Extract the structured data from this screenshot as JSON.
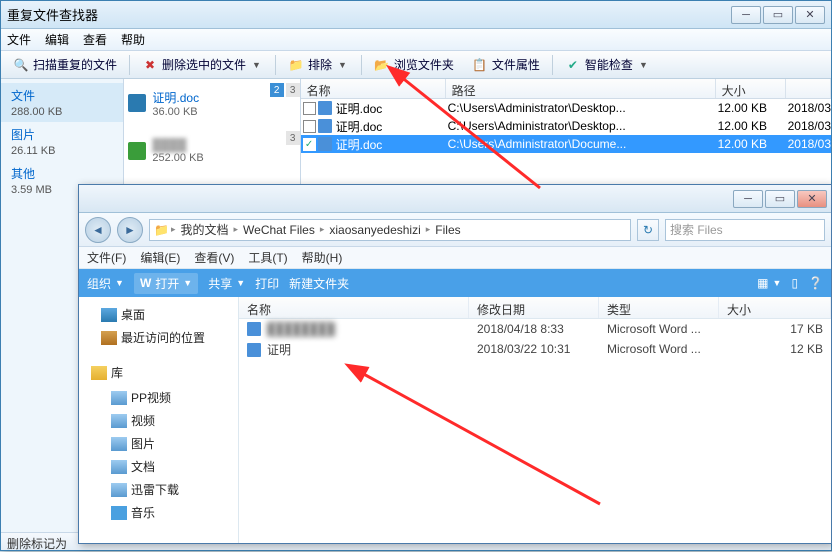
{
  "win1": {
    "title": "重复文件查找器",
    "menu": {
      "file": "文件",
      "edit": "编辑",
      "view": "查看",
      "help": "帮助"
    },
    "toolbar": {
      "scan": "扫描重复的文件",
      "del": "删除选中的文件",
      "sort": "排除",
      "browse": "  浏览文件夹",
      "prop": "文件属性",
      "smart": "智能检查"
    },
    "cats": [
      {
        "label": "文件",
        "size": "288.00 KB"
      },
      {
        "label": "图片",
        "size": "26.11 KB"
      },
      {
        "label": "其他",
        "size": "3.59 MB"
      }
    ],
    "thumbs": [
      {
        "name": "证明.doc",
        "size": "36.00 KB",
        "tabs": [
          "2",
          "3"
        ]
      },
      {
        "name": "",
        "size": "252.00 KB",
        "tabs": [
          "3"
        ]
      }
    ],
    "listhdr": {
      "name": "名称",
      "path": "路径",
      "size": "大小",
      "date": ""
    },
    "rows": [
      {
        "chk": false,
        "name": "证明.doc",
        "path": "C:\\Users\\Administrator\\Desktop...",
        "size": "12.00 KB",
        "date": "2018/03"
      },
      {
        "chk": false,
        "name": "证明.doc",
        "path": "C:\\Users\\Administrator\\Desktop...",
        "size": "12.00 KB",
        "date": "2018/03"
      },
      {
        "chk": true,
        "name": "证明.doc",
        "path": "C:\\Users\\Administrator\\Docume...",
        "size": "12.00 KB",
        "date": "2018/03",
        "sel": true
      }
    ],
    "status": "删除标记为"
  },
  "win2": {
    "crumbs": [
      "我的文档",
      "WeChat Files",
      "xiaosanyedeshizi",
      "Files"
    ],
    "searchPlaceholder": "搜索 Files",
    "menu": {
      "file": "文件(F)",
      "edit": "编辑(E)",
      "view": "查看(V)",
      "tools": "工具(T)",
      "help": "帮助(H)"
    },
    "orgbar": {
      "org": "组织",
      "open": "打开",
      "share": "共享",
      "print": "打印",
      "newfolder": "新建文件夹"
    },
    "tree": [
      {
        "label": "桌面",
        "cls": "ico-desktop"
      },
      {
        "label": "最近访问的位置",
        "cls": "ico-recent"
      },
      {
        "label": "库",
        "lib": true,
        "cls": "ico-lib"
      },
      {
        "label": "PP视频",
        "child": true,
        "cls": "ico-generic"
      },
      {
        "label": "视频",
        "child": true,
        "cls": "ico-generic"
      },
      {
        "label": "图片",
        "child": true,
        "cls": "ico-generic"
      },
      {
        "label": "文档",
        "child": true,
        "cls": "ico-generic"
      },
      {
        "label": "迅雷下载",
        "child": true,
        "cls": "ico-generic"
      },
      {
        "label": "音乐",
        "child": true,
        "cls": "ico-music"
      }
    ],
    "fhdr": {
      "name": "名称",
      "date": "修改日期",
      "type": "类型",
      "size": "大小"
    },
    "frows": [
      {
        "name": "",
        "blur": true,
        "date": "2018/04/18 8:33",
        "type": "Microsoft Word ...",
        "size": "17 KB"
      },
      {
        "name": "证明",
        "date": "2018/03/22 10:31",
        "type": "Microsoft Word ...",
        "size": "12 KB"
      }
    ]
  }
}
